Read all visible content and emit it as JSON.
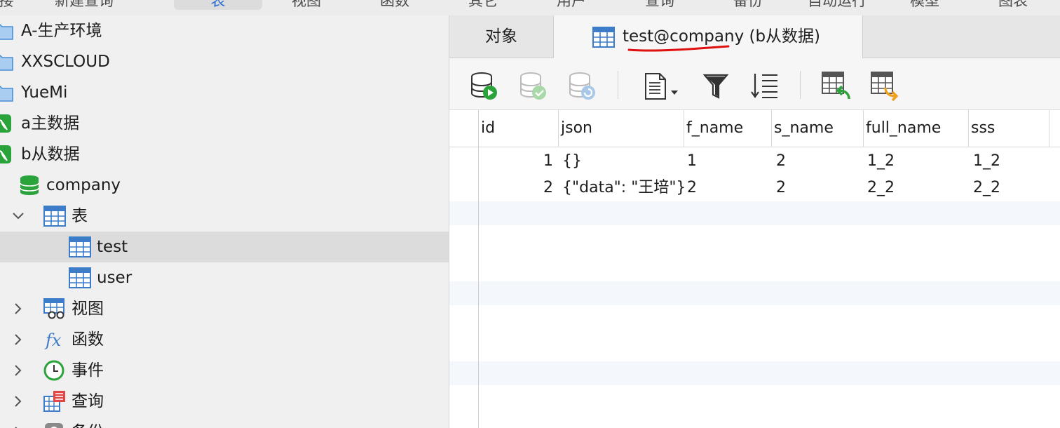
{
  "top_toolbar": {
    "items": [
      {
        "label": "接",
        "selected": false
      },
      {
        "label": "新建查询",
        "selected": false
      },
      {
        "label": "表",
        "selected": true
      },
      {
        "label": "视图",
        "selected": false
      },
      {
        "label": "函数",
        "selected": false
      },
      {
        "label": "其它",
        "selected": false
      },
      {
        "label": "用户",
        "selected": false
      },
      {
        "label": "查询",
        "selected": false
      },
      {
        "label": "备份",
        "selected": false
      },
      {
        "label": "自动运行",
        "selected": false
      },
      {
        "label": "模型",
        "selected": false
      },
      {
        "label": "图表",
        "selected": false
      }
    ]
  },
  "sidebar": {
    "items": [
      {
        "label": "A-生产环境",
        "icon": "folder-icon"
      },
      {
        "label": "XXSCLOUD",
        "icon": "folder-icon"
      },
      {
        "label": "YueMi",
        "icon": "folder-icon"
      },
      {
        "label": "a主数据",
        "icon": "connection-icon"
      },
      {
        "label": "b从数据",
        "icon": "connection-icon"
      },
      {
        "label": "company",
        "icon": "database-icon"
      },
      {
        "label": "表",
        "icon": "table-icon",
        "expanded": true
      },
      {
        "label": "test",
        "icon": "table-icon",
        "selected": true
      },
      {
        "label": "user",
        "icon": "table-icon"
      },
      {
        "label": "视图",
        "icon": "view-icon",
        "expanded": false
      },
      {
        "label": "函数",
        "icon": "function-icon",
        "expanded": false
      },
      {
        "label": "事件",
        "icon": "event-icon",
        "expanded": false
      },
      {
        "label": "查询",
        "icon": "query-icon",
        "expanded": false
      },
      {
        "label": "备份",
        "icon": "backup-icon",
        "expanded": false
      }
    ]
  },
  "tabs": {
    "objects_label": "对象",
    "active_label": "test@company (b从数据)"
  },
  "grid": {
    "columns": [
      "id",
      "json",
      "f_name",
      "s_name",
      "full_name",
      "sss"
    ],
    "rows": [
      [
        "1",
        "{}",
        "1",
        "2",
        "1_2",
        "1_2"
      ],
      [
        "2",
        "{\"data\": \"王培\"}",
        "2",
        "2",
        "2_2",
        "2_2"
      ]
    ]
  },
  "colors": {
    "accent": "#2b6bd1",
    "table_icon_blue": "#3d7cc9",
    "annotation_red": "#e01010",
    "db_green": "#2aa33b"
  }
}
